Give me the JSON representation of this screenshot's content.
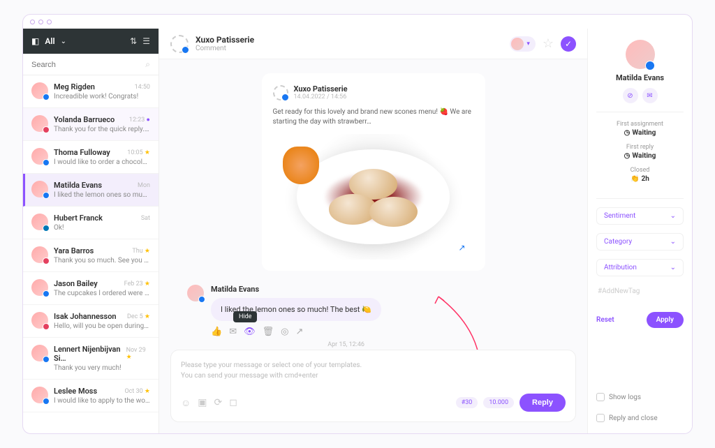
{
  "sidebar": {
    "all_label": "All",
    "search_placeholder": "Search",
    "conversations": [
      {
        "name": "Meg Rigden",
        "time": "14:50",
        "preview": "Increadible work! Congrats!",
        "badge": "fb"
      },
      {
        "name": "Yolanda Barrueco",
        "time": "12:23",
        "preview": "Thank you for the quick reply. I will inf…",
        "badge": "ig",
        "indicator": "dot",
        "highlighted": true
      },
      {
        "name": "Thoma Fulloway",
        "time": "10:05",
        "preview": "I would like to order a chocolate cake…",
        "badge": "fb",
        "indicator": "star"
      },
      {
        "name": "Matilda Evans",
        "time": "Mon",
        "preview": "I liked the lemon ones so much! T…",
        "badge": "fb",
        "selected": true
      },
      {
        "name": "Hubert Franck",
        "time": "Sat",
        "preview": "Ok!",
        "badge": "li"
      },
      {
        "name": "Yara Barros",
        "time": "Thu",
        "preview": "Thank you so much. See you tom…",
        "badge": "ig",
        "indicator": "star"
      },
      {
        "name": "Jason Bailey",
        "time": "Feb 23",
        "preview": "The cupcakes I ordered were delicio…",
        "badge": "fb",
        "indicator": "star"
      },
      {
        "name": "Isak Johannesson",
        "time": "Dec 5",
        "preview": "Hello, will you be open during the holi…",
        "badge": "ig",
        "indicator": "star"
      },
      {
        "name": "Lennert Nijenbijvan Si…",
        "time": "Nov 29",
        "preview": "Thank you very much!",
        "badge": "fb",
        "indicator": "star"
      },
      {
        "name": "Leslee Moss",
        "time": "Oct 30",
        "preview": "I would like to apply to the workshop…",
        "badge": "fb",
        "indicator": "star"
      }
    ]
  },
  "header": {
    "title": "Xuxo Patisserie",
    "subtitle": "Comment"
  },
  "post": {
    "name": "Xuxo Patisserie",
    "date": "14.04.2022 / 14:56",
    "text": "Get ready for this lovely and brand new scones menu! 🍓 We are starting the day with strawberr…"
  },
  "comment": {
    "name": "Matilda Evans",
    "text": "I liked the lemon ones so much! The best 🍋",
    "time": "Apr 15, 12:46",
    "tooltip": "Hide"
  },
  "composer": {
    "placeholder_line1": "Please type your message or select one of your templates.",
    "placeholder_line2": "You can send your message with cmd+enter",
    "tag1": "#30",
    "tag2": "10.000",
    "reply": "Reply"
  },
  "profile": {
    "name": "Matilda Evans",
    "first_assignment_label": "First assignment",
    "first_assignment_value": "Waiting",
    "first_reply_label": "First reply",
    "first_reply_value": "Waiting",
    "closed_label": "Closed",
    "closed_value": "2h",
    "sentiment": "Sentiment",
    "category": "Category",
    "attribution": "Attribution",
    "add_tag": "#AddNewTag",
    "reset": "Reset",
    "apply": "Apply",
    "show_logs": "Show logs",
    "reply_and_close": "Reply and close"
  }
}
